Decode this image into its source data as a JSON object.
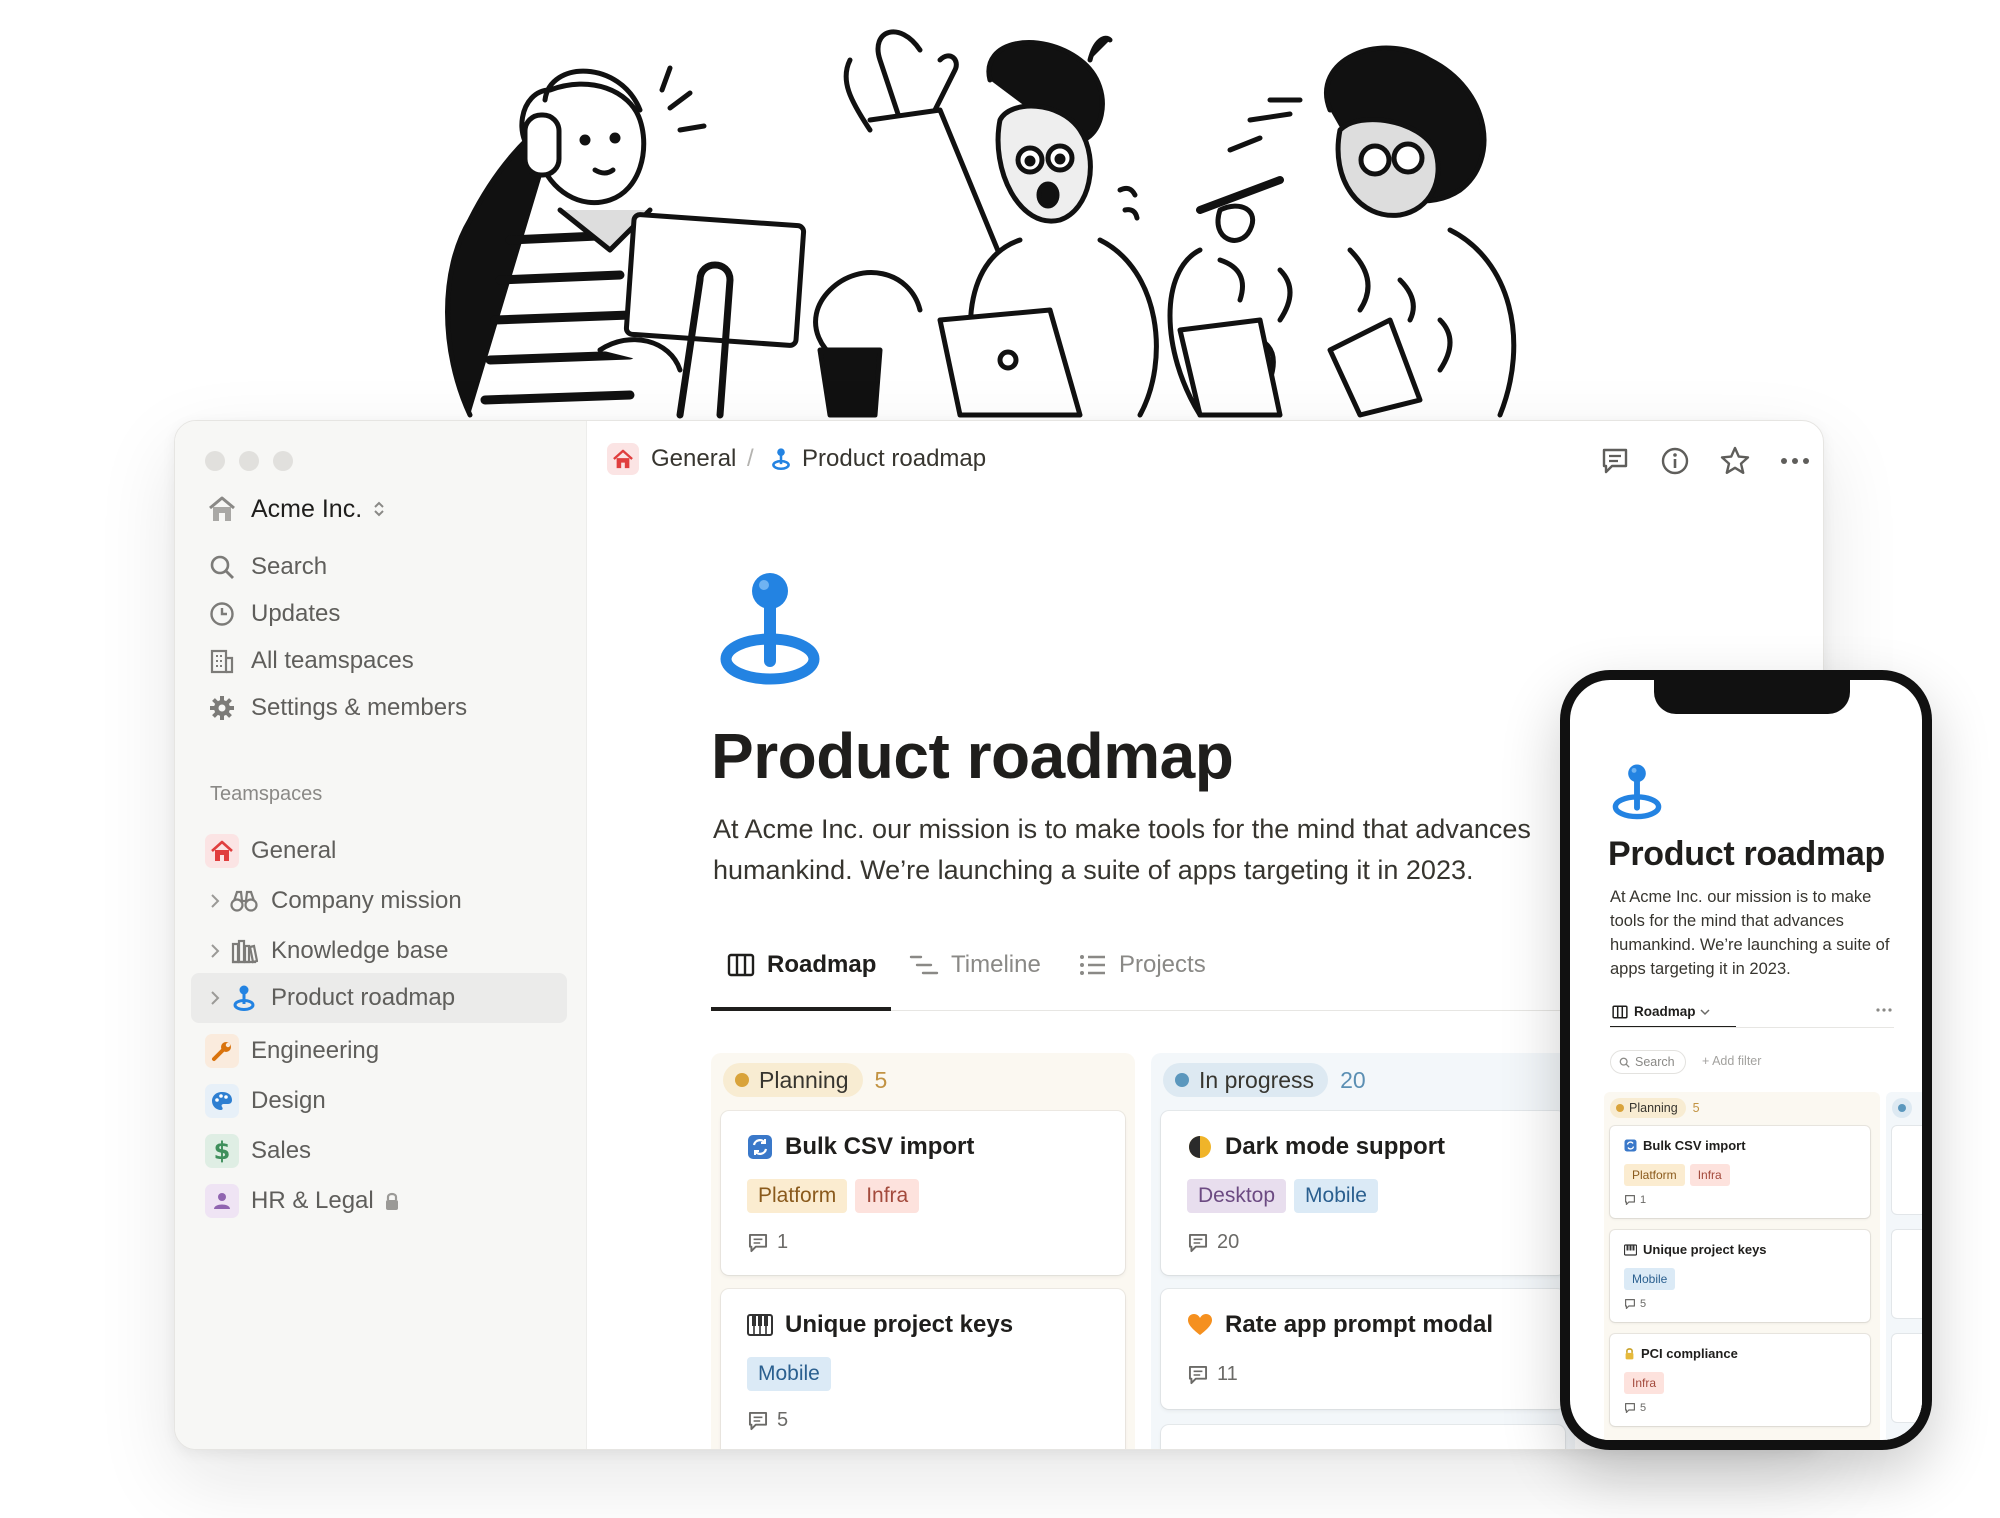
{
  "window": {
    "workspace_name": "Acme Inc.",
    "nav": [
      {
        "label": "Search",
        "icon": "search-icon"
      },
      {
        "label": "Updates",
        "icon": "clock-icon"
      },
      {
        "label": "All teamspaces",
        "icon": "building-icon"
      },
      {
        "label": "Settings & members",
        "icon": "gear-icon"
      }
    ],
    "teamspaces_label": "Teamspaces",
    "teamspaces": [
      {
        "label": "General",
        "icon": "house-icon",
        "color": "#e03e3e"
      },
      {
        "label": "Company mission",
        "icon": "binoculars-icon"
      },
      {
        "label": "Knowledge base",
        "icon": "library-icon"
      },
      {
        "label": "Product roadmap",
        "icon": "anchor-pin-icon",
        "selected": true
      },
      {
        "label": "Engineering",
        "icon": "wrench-icon",
        "color": "#d9730d"
      },
      {
        "label": "Design",
        "icon": "palette-icon",
        "color": "#2e7fd1"
      },
      {
        "label": "Sales",
        "icon": "dollar-icon",
        "color": "#3f8f5c"
      },
      {
        "label": "HR & Legal",
        "icon": "person-icon",
        "color": "#9065b0"
      }
    ]
  },
  "breadcrumb": {
    "parent": "General",
    "separator": "/",
    "current": "Product roadmap"
  },
  "page": {
    "title": "Product roadmap",
    "description": "At Acme Inc. our mission is to make tools for the mind that advances humankind. We’re launching a suite of apps targeting it in 2023."
  },
  "tabs": [
    {
      "label": "Roadmap",
      "active": true
    },
    {
      "label": "Timeline"
    },
    {
      "label": "Projects"
    }
  ],
  "board": {
    "columns": [
      {
        "label": "Planning",
        "count": "5",
        "dot_color": "#d9a33a",
        "cards": [
          {
            "title": "Bulk CSV import",
            "icon": "arrows-cycle-icon",
            "tags": [
              "Platform",
              "Infra"
            ],
            "comments": "1"
          },
          {
            "title": "Unique project keys",
            "icon": "piano-keys-icon",
            "tags": [
              "Mobile"
            ],
            "comments": "5"
          }
        ]
      },
      {
        "label": "In progress",
        "count": "20",
        "dot_color": "#5b97bd",
        "cards": [
          {
            "title": "Dark mode support",
            "icon": "half-moon-icon",
            "tags": [
              "Desktop",
              "Mobile"
            ],
            "comments": "20"
          },
          {
            "title": "Rate app prompt modal",
            "icon": "orange-heart-icon",
            "tags": [],
            "comments": "11"
          }
        ]
      }
    ]
  },
  "phone": {
    "title": "Product roadmap",
    "description": "At Acme Inc. our mission is to make tools for the mind that advances humankind. We’re launching a suite of apps targeting it in 2023.",
    "view_label": "Roadmap",
    "search_label": "Search",
    "add_filter_label": "+ Add filter",
    "column_label": "Planning",
    "column_count": "5",
    "cards": [
      {
        "title": "Bulk CSV import",
        "tags": [
          "Platform",
          "Infra"
        ],
        "comments": "1"
      },
      {
        "title": "Unique project keys",
        "tags": [
          "Mobile"
        ],
        "comments": "5"
      },
      {
        "title": "PCI compliance",
        "tags": [
          "Infra"
        ],
        "comments": "5"
      }
    ]
  },
  "colors": {
    "accent_blue": "#2383e2",
    "planning_bg": "#fbf8f1",
    "inprogress_bg": "#f3f7fa",
    "tag_platform": "#fbecd0",
    "tag_infra": "#fde2dd",
    "tag_mobile": "#dbeaf6",
    "tag_desktop": "#e8deee"
  }
}
